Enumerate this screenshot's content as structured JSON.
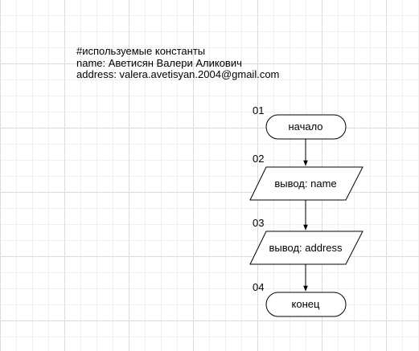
{
  "note": {
    "lines": [
      "#используемые константы",
      "name: Аветисян Валери Аликович",
      "address: valera.avetisyan.2004@gmail.com"
    ]
  },
  "flowchart": {
    "nodes": [
      {
        "number": "01",
        "shape": "terminator",
        "text": "начало"
      },
      {
        "number": "02",
        "shape": "io",
        "text": "вывод: name"
      },
      {
        "number": "03",
        "shape": "io",
        "text": "вывод: address"
      },
      {
        "number": "04",
        "shape": "terminator",
        "text": "конец"
      }
    ]
  },
  "colors": {
    "stroke": "#000000",
    "fill": "#ffffff",
    "grid": "#dcdcdc"
  }
}
